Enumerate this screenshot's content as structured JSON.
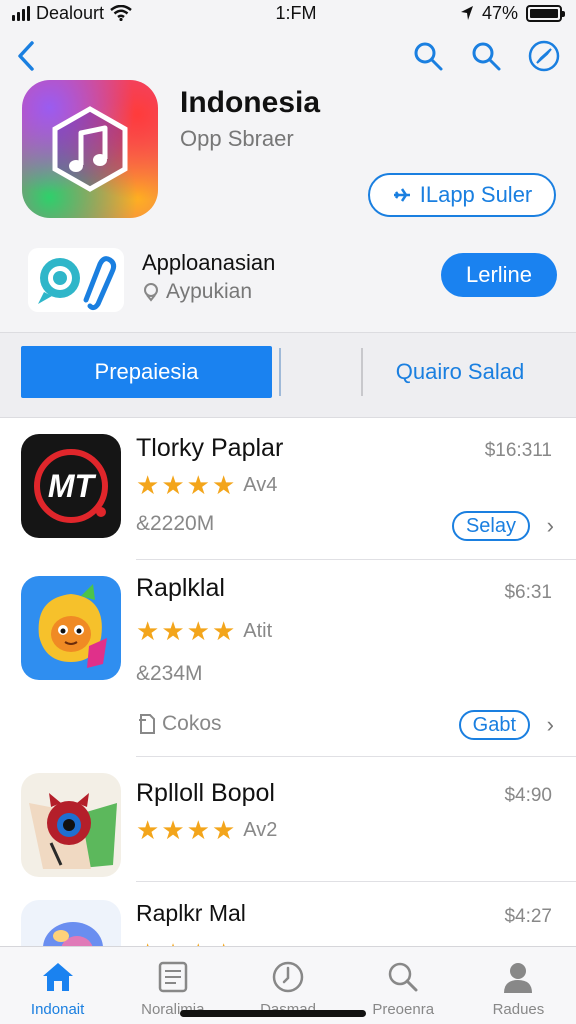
{
  "status_bar": {
    "carrier": "Dealourt",
    "time": "1:FM",
    "battery": "47%"
  },
  "nav": {
    "back_icon": "chevron-left-icon",
    "icons": [
      "search-icon",
      "search-icon",
      "compass-icon"
    ]
  },
  "app": {
    "title": "Indonesia",
    "subtitle": "Opp Sbraer",
    "outline_button": "ILapp Suler",
    "icon": "music-note-icon"
  },
  "developer": {
    "name": "Apploanasian",
    "sub": "Aypukian",
    "button": "Lerline"
  },
  "segments": {
    "active": "Prepaiesia",
    "inactive": "Quairo Salad"
  },
  "list": {
    "items": [
      {
        "name": "Tlorky Paplar",
        "price": "$16:311",
        "stars": 4,
        "rating": "Av4",
        "count": "&2220M",
        "action": "Selay"
      },
      {
        "name": "Raplklal",
        "price": "$6:31",
        "stars": 4,
        "rating": "Atit",
        "count": "&234M",
        "extra": "Cokos",
        "action": "Gabt"
      },
      {
        "name": "Rplloll Bopol",
        "price": "$4:90",
        "stars": 4,
        "rating": "Av2"
      },
      {
        "name": "Raplkr Mal",
        "price": "$4:27",
        "stars": 4
      }
    ]
  },
  "tabbar": {
    "tabs": [
      {
        "label": "Indonait",
        "icon": "home-icon",
        "active": true
      },
      {
        "label": "Noralimia",
        "icon": "news-icon",
        "active": false
      },
      {
        "label": "Dasmad",
        "icon": "clock-icon",
        "active": false
      },
      {
        "label": "Preoenra",
        "icon": "search-icon",
        "active": false
      },
      {
        "label": "Radues",
        "icon": "person-icon",
        "active": false
      }
    ]
  },
  "colors": {
    "accent": "#1a82f0",
    "star": "#f3a51b"
  }
}
